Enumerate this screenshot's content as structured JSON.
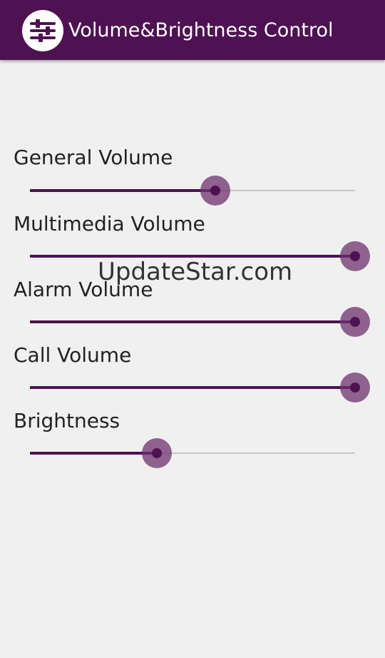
{
  "app": {
    "title": "Volume&Brightness Control",
    "icon": "sliders-icon",
    "bar_color": "#4e1252",
    "accent_color": "#4e1252"
  },
  "settings": [
    {
      "label": "General Volume",
      "value": 0.57
    },
    {
      "label": "Multimedia Volume",
      "value": 1.0
    },
    {
      "label": "Alarm Volume",
      "value": 1.0
    },
    {
      "label": "Call Volume",
      "value": 1.0
    },
    {
      "label": "Brightness",
      "value": 0.39
    }
  ],
  "watermark": "UpdateStar.com"
}
